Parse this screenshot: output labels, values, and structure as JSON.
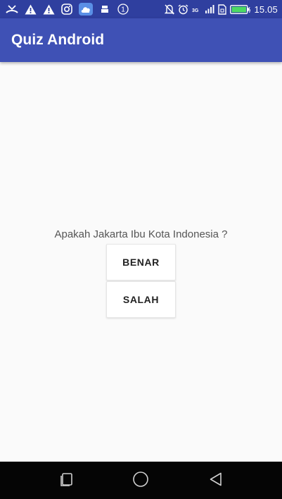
{
  "status_bar": {
    "time": "15.05",
    "network_label": "3G",
    "notification_badge": "1",
    "colors": {
      "background": "#2f3f9f",
      "foreground": "#ffffff"
    },
    "left_icons": [
      "missed-call-icon",
      "warning-icon",
      "warning-icon",
      "instagram-icon",
      "cloud-icon",
      "usb-icon",
      "notification-count-icon"
    ],
    "right_icons": [
      "mute-icon",
      "alarm-icon",
      "network-type-icon",
      "signal-icon",
      "no-sim-icon",
      "battery-icon"
    ]
  },
  "app_bar": {
    "title": "Quiz Android",
    "color": "#3f51b5"
  },
  "quiz": {
    "question": "Apakah Jakarta Ibu Kota Indonesia ?",
    "true_button_label": "BENAR",
    "false_button_label": "SALAH"
  },
  "nav_bar": {
    "icons": [
      "recent-apps-icon",
      "home-icon",
      "back-icon"
    ],
    "color": "#050505"
  }
}
